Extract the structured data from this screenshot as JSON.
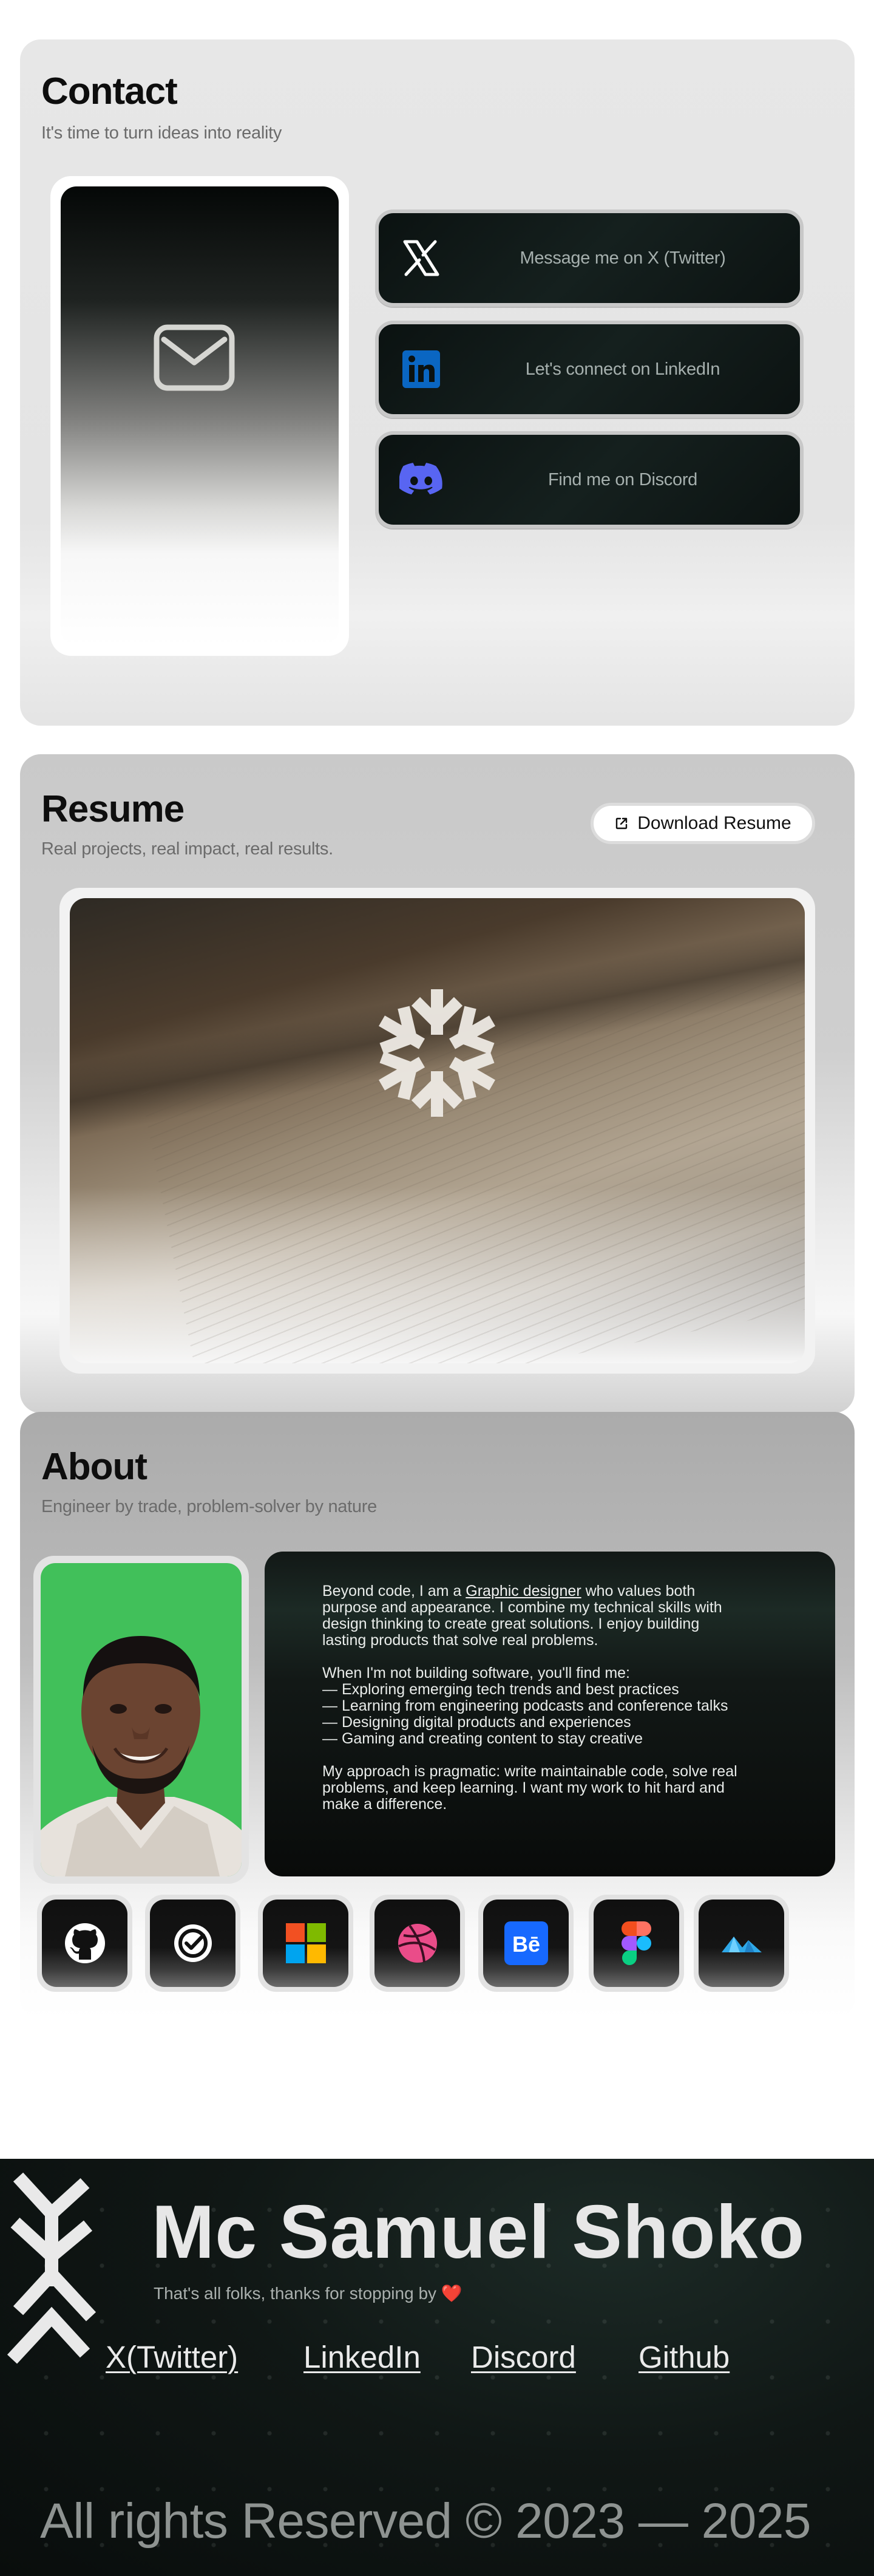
{
  "contact": {
    "title": "Contact",
    "subtitle": "It's time to turn ideas into reality",
    "mail_icon": "mail-icon",
    "links": [
      {
        "icon": "x-twitter-icon",
        "label": "Message me on X (Twitter)"
      },
      {
        "icon": "linkedin-icon",
        "label": "Let's connect on LinkedIn"
      },
      {
        "icon": "discord-icon",
        "label": "Find me on Discord"
      }
    ]
  },
  "resume": {
    "title": "Resume",
    "subtitle": "Real projects, real impact, real results.",
    "download_label": "Download Resume",
    "download_icon": "external-link-icon"
  },
  "about": {
    "title": "About",
    "subtitle": "Engineer by trade, problem-solver by nature",
    "p1_before": "Beyond code, I am a ",
    "p1_link": "Graphic designer",
    "p1_after": " who values both purpose and appearance. I combine my technical skills with design thinking to create great solutions. I enjoy building lasting products that solve real problems.",
    "p2_intro": "When I'm not building software, you'll find me:",
    "p2_items": [
      "— Exploring emerging tech trends and best practices",
      "— Learning from engineering podcasts and conference talks",
      "— Designing digital products and experiences",
      "— Gaming and creating content to stay creative"
    ],
    "p3": "My approach is pragmatic: write maintainable code, solve real problems, and keep learning. I want my work to hit hard and make a difference.",
    "stack_icons": [
      "github-icon",
      "ticktick-icon",
      "microsoft-icon",
      "dribbble-icon",
      "behance-icon",
      "figma-icon",
      "mountain-logo-icon"
    ]
  },
  "footer": {
    "name": "Mc Samuel Shoko",
    "thanks": "That's all folks, thanks for stopping by",
    "heart": "❤️",
    "links": [
      "X(Twitter)",
      "LinkedIn",
      "Discord",
      "Github"
    ],
    "rights": "All rights Reserved © 2023 — 2025"
  },
  "colors": {
    "footer_bg": "#0e1513",
    "photo_bg": "#41c05a",
    "button_dark": "#0f1816"
  }
}
